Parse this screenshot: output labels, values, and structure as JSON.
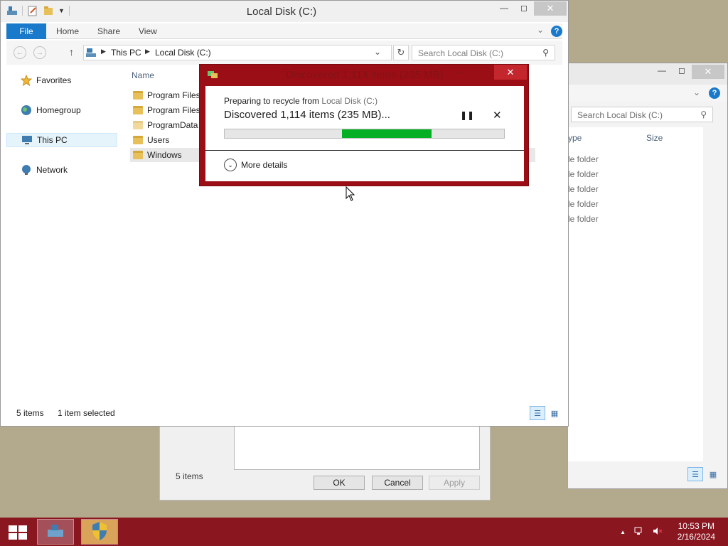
{
  "main_window": {
    "title": "Local Disk (C:)",
    "tabs": {
      "file": "File",
      "home": "Home",
      "share": "Share",
      "view": "View"
    },
    "breadcrumb": [
      "This PC",
      "Local Disk (C:)"
    ],
    "search_placeholder": "Search Local Disk (C:)",
    "nav": {
      "favorites": "Favorites",
      "homegroup": "Homegroup",
      "this_pc": "This PC",
      "network": "Network"
    },
    "column_name": "Name",
    "files": [
      "Program Files",
      "Program Files",
      "ProgramData",
      "Users",
      "Windows"
    ],
    "status_items": "5 items",
    "status_selected": "1 item selected"
  },
  "back_window": {
    "search_placeholder": "Search Local Disk (C:)",
    "col_type": "ype",
    "col_size": "Size",
    "rows": [
      "le folder",
      "le folder",
      "le folder",
      "le folder",
      "le folder"
    ]
  },
  "props_dialog": {
    "items": "5 items",
    "ok": "OK",
    "cancel": "Cancel",
    "apply": "Apply"
  },
  "recycle_dialog": {
    "title": "Discovered 1,114 items (235 MB)",
    "prep_label": "Preparing to recycle from ",
    "prep_location": "Local Disk (C:)",
    "status": "Discovered 1,114 items (235 MB)...",
    "progress_start": 0.42,
    "progress_end": 0.74,
    "more_details": "More details"
  },
  "taskbar": {
    "time": "10:53 PM",
    "date": "2/16/2024"
  },
  "colors": {
    "accent_file_tab": "#1979ca",
    "dialog_frame": "#9c0e15",
    "progress_fill": "#06b025",
    "taskbar": "#8a1620"
  }
}
